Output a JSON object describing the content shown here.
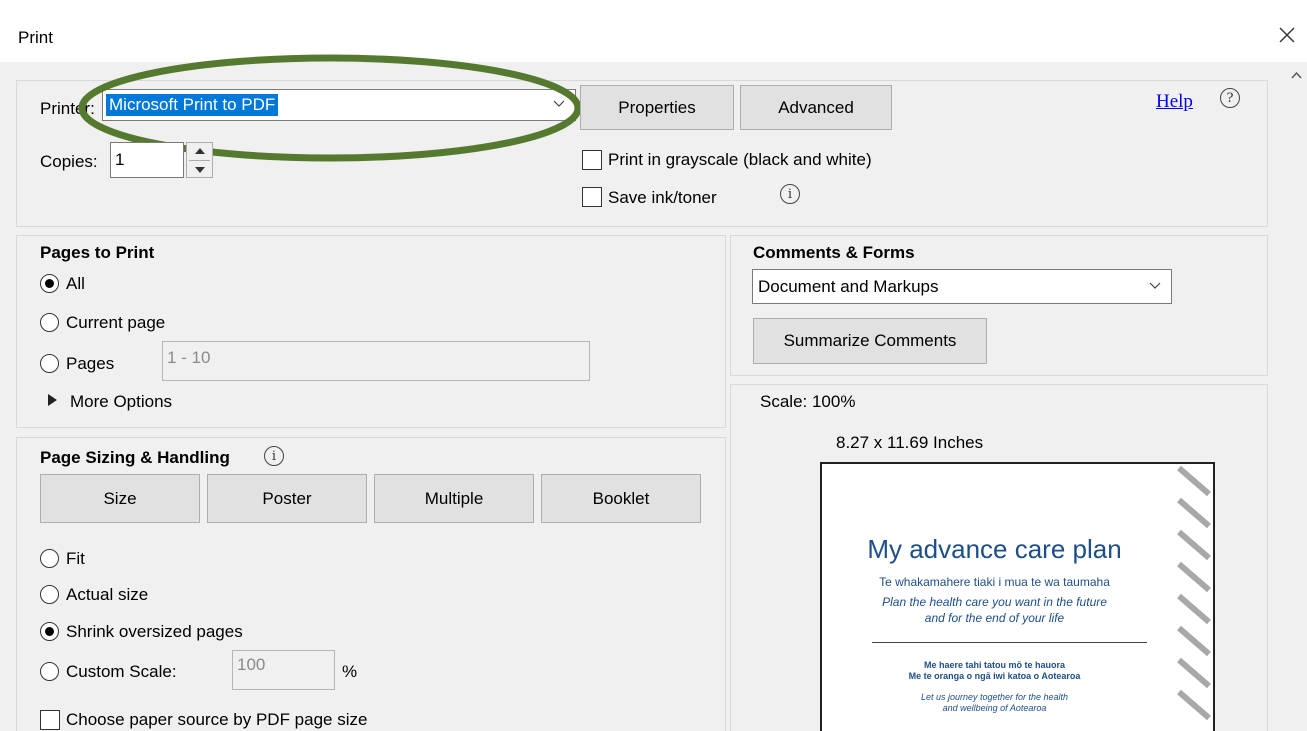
{
  "window": {
    "title": "Print"
  },
  "printer": {
    "label": "Printer:",
    "selected": "Microsoft Print to PDF",
    "properties_label": "Properties",
    "advanced_label": "Advanced",
    "help_label": "Help",
    "copies_label": "Copies:",
    "copies_value": "1",
    "grayscale_label": "Print in grayscale (black and white)",
    "saveink_label": "Save ink/toner"
  },
  "pages_to_print": {
    "heading": "Pages to Print",
    "all_label": "All",
    "current_label": "Current page",
    "pages_label": "Pages",
    "pages_range": "1 - 10",
    "more_options_label": "More Options",
    "selected": "All"
  },
  "comments_forms": {
    "heading": "Comments & Forms",
    "selected": "Document and Markups",
    "summarize_label": "Summarize Comments"
  },
  "page_sizing": {
    "heading": "Page Sizing & Handling",
    "tabs": [
      "Size",
      "Poster",
      "Multiple",
      "Booklet"
    ],
    "fit_label": "Fit",
    "actual_label": "Actual size",
    "shrink_label": "Shrink oversized pages",
    "custom_label": "Custom Scale:",
    "custom_value": "100",
    "percent": "%",
    "paper_source_label": "Choose paper source by PDF page size",
    "selected": "Shrink oversized pages"
  },
  "preview": {
    "scale": "Scale: 100%",
    "dimensions": "8.27 x 11.69 Inches",
    "doc_title": "My advance care plan",
    "doc_maori": "Te whakamahere tiaki i mua te wa taumaha",
    "doc_tagline_1": "Plan the health care you want in the future",
    "doc_tagline_2": "and for the end of your life",
    "doc_maori_2a": "Me haere tahi tatou mō te hauora",
    "doc_maori_2b": "Me te oranga o ngā iwi katoa o Aotearoa",
    "doc_eng_2a": "Let us journey together for the health",
    "doc_eng_2b": "and wellbeing of Aotearoa"
  },
  "colors": {
    "highlight": "#0078d7",
    "annotation_ellipse": "#557a2f",
    "link": "#0000ee",
    "doc_blue": "#1d4e89"
  }
}
